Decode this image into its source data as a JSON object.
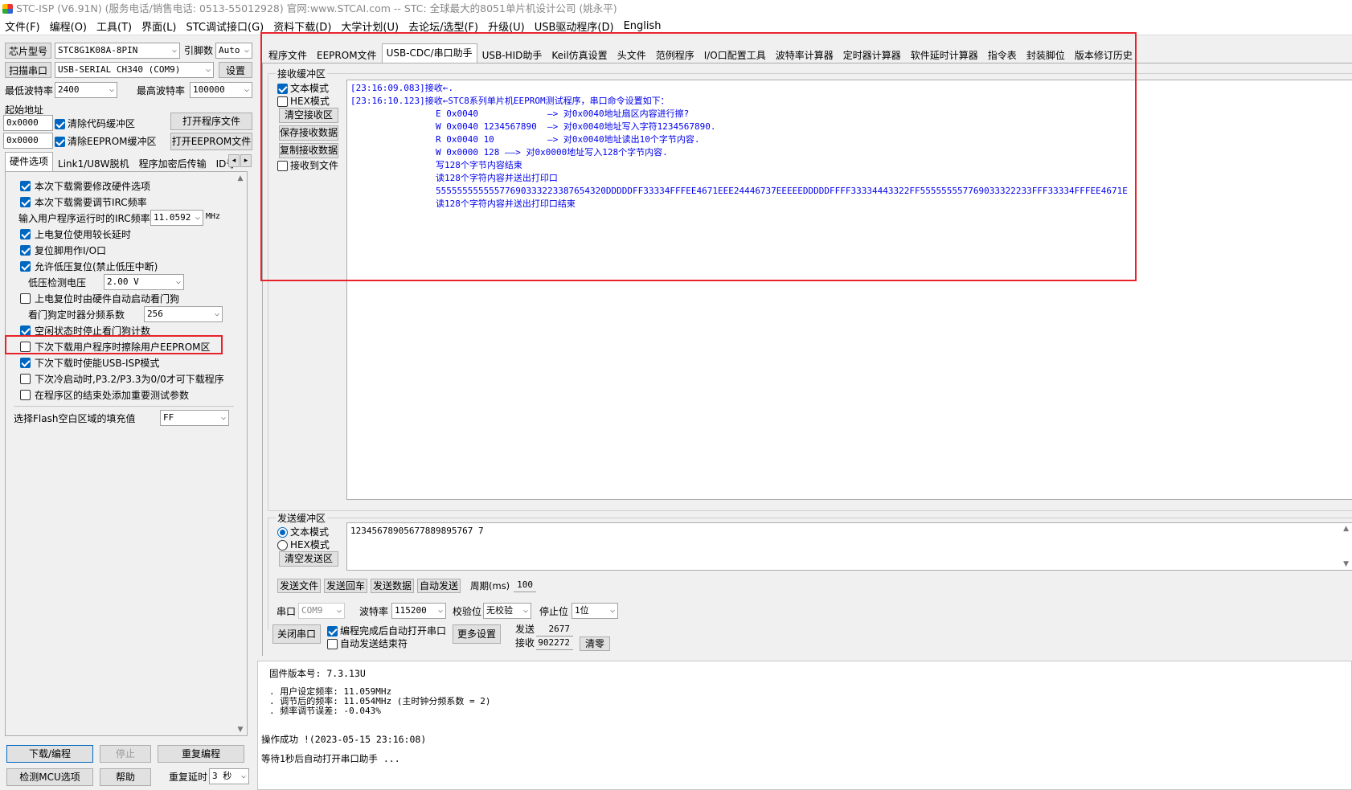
{
  "window": {
    "title": "STC-ISP (V6.91N) (服务电话/销售电话: 0513-55012928) 官网:www.STCAI.com  -- STC: 全球最大的8051单片机设计公司 (姚永平)"
  },
  "menu": [
    "文件(F)",
    "编程(O)",
    "工具(T)",
    "界面(L)",
    "STC调试接口(G)",
    "资料下载(D)",
    "大学计划(U)",
    "去论坛/选型(F)",
    "升级(U)",
    "USB驱动程序(D)",
    "English"
  ],
  "left": {
    "chip_label": "芯片型号",
    "chip_value": "STC8G1K08A-8PIN",
    "pins_label": "引脚数",
    "pins_value": "Auto",
    "scan_button": "扫描串口",
    "port_value": "USB-SERIAL CH340 (COM9)",
    "settings_button": "设置",
    "min_baud_label": "最低波特率",
    "min_baud_value": "2400",
    "max_baud_label": "最高波特率",
    "max_baud_value": "100000",
    "start_addr_label": "起始地址",
    "code_addr": "0x0000",
    "clear_code_label": "清除代码缓冲区",
    "open_program_button": "打开程序文件",
    "eeprom_addr": "0x0000",
    "clear_eeprom_label": "清除EEPROM缓冲区",
    "open_eeprom_button": "打开EEPROM文件",
    "tabs": [
      "硬件选项",
      "Link1/U8W脱机",
      "程序加密后传输",
      "ID号"
    ],
    "tab_scroll_left": "◂",
    "tab_scroll_right": "▸",
    "options": [
      {
        "label": "本次下载需要修改硬件选项",
        "checked": true
      },
      {
        "label": "本次下载需要调节IRC频率",
        "checked": true
      },
      {
        "label": "上电复位使用较长延时",
        "checked": true
      },
      {
        "label": "复位脚用作I/O口",
        "checked": true
      },
      {
        "label": "允许低压复位(禁止低压中断)",
        "checked": true
      },
      {
        "label": "上电复位时由硬件自动启动看门狗",
        "checked": false
      },
      {
        "label": "空闲状态时停止看门狗计数",
        "checked": true
      },
      {
        "label": "下次下载用户程序时擦除用户EEPROM区",
        "checked": false
      },
      {
        "label": "下次下载时使能USB-ISP模式",
        "checked": true
      },
      {
        "label": "下次冷启动时,P3.2/P3.3为0/0才可下载程序",
        "checked": false
      },
      {
        "label": "在程序区的结束处添加重要测试参数",
        "checked": false
      }
    ],
    "irc_label": "输入用户程序运行时的IRC频率",
    "irc_value": "11.0592",
    "irc_unit": "MHz",
    "lvd_label": "低压检测电压",
    "lvd_value": "2.00 V",
    "wdt_label": "看门狗定时器分频系数",
    "wdt_value": "256",
    "flash_fill_label": "选择Flash空白区域的填充值",
    "flash_fill_value": "FF",
    "scroll_up": "▲",
    "scroll_down": "▼",
    "download_button": "下载/编程",
    "stop_button": "停止",
    "reprogram_button": "重复编程",
    "detect_button": "检测MCU选项",
    "help_button": "帮助",
    "repeat_delay_label": "重复延时",
    "repeat_delay_value": "3 秒"
  },
  "tabs": [
    "程序文件",
    "EEPROM文件",
    "USB-CDC/串口助手",
    "USB-HID助手",
    "Keil仿真设置",
    "头文件",
    "范例程序",
    "I/O口配置工具",
    "波特率计算器",
    "定时器计算器",
    "软件延时计算器",
    "指令表",
    "封装脚位",
    "版本修订历史"
  ],
  "receive": {
    "group_label": "接收缓冲区",
    "text_mode": "文本模式",
    "hex_mode": "HEX模式",
    "clear_button": "清空接收区",
    "save_button": "保存接收数据",
    "copy_button": "复制接收数据",
    "to_file": "接收到文件",
    "lines": [
      "[23:16:09.083]接收←.",
      "[23:16:10.123]接收←STC8系列单片机EEPROM测试程序，串口命令设置如下：",
      "                E 0x0040             —> 对0x0040地址扇区内容进行擦?",
      "                W 0x0040 1234567890  —> 对0x0040地址写入字符1234567890.",
      "                R 0x0040 10          —> 对0x0040地址读出10个字节内容.",
      "                W 0x0000 128 ——> 对0x0000地址写入128个字节内容.",
      "                写128个字节内容结束",
      "                读128个字符内容并送出打印口",
      "                55555555555577690333223387654320DDDDDFF33334FFFEE4671EEE24446737EEEEEDDDDDFFFF33334443322FF555555557769033322233FFF33334FFFEE4671E",
      "                读128个字符内容并送出打印口结束"
    ]
  },
  "send": {
    "group_label": "发送缓冲区",
    "text_mode": "文本模式",
    "hex_mode": "HEX模式",
    "clear_button": "清空发送区",
    "content": "12345678905677889895767 7",
    "send_file": "发送文件",
    "send_cr": "发送回车",
    "send_data": "发送数据",
    "auto_send": "自动发送",
    "period_label": "周期(ms)",
    "period_value": "100"
  },
  "serial": {
    "port_label": "串口",
    "port_value": "COM9",
    "baud_label": "波特率",
    "baud_value": "115200",
    "parity_label": "校验位",
    "parity_value": "无校验",
    "stop_label": "停止位",
    "stop_value": "1位",
    "close_button": "关闭串口",
    "auto_open_label": "编程完成后自动打开串口",
    "auto_end_label": "自动发送结束符",
    "more_button": "更多设置",
    "sent_label": "发送",
    "sent_value": "2677",
    "recv_label": "接收",
    "recv_value": "902272",
    "clear_button": "清零"
  },
  "log": {
    "firmware": "固件版本号: 7.3.13U",
    "freq_lines": [
      ". 用户设定频率: 11.059MHz",
      ". 调节后的频率: 11.054MHz (主时钟分频系数 = 2)",
      ". 频率调节误差: -0.043%"
    ],
    "success": "操作成功 !(2023-05-15 23:16:08)",
    "waiting": "等待1秒后自动打开串口助手 ..."
  },
  "colors": {
    "highlight": "#e8222a",
    "check": "#0067c0",
    "rx_text": "#0000ee"
  }
}
